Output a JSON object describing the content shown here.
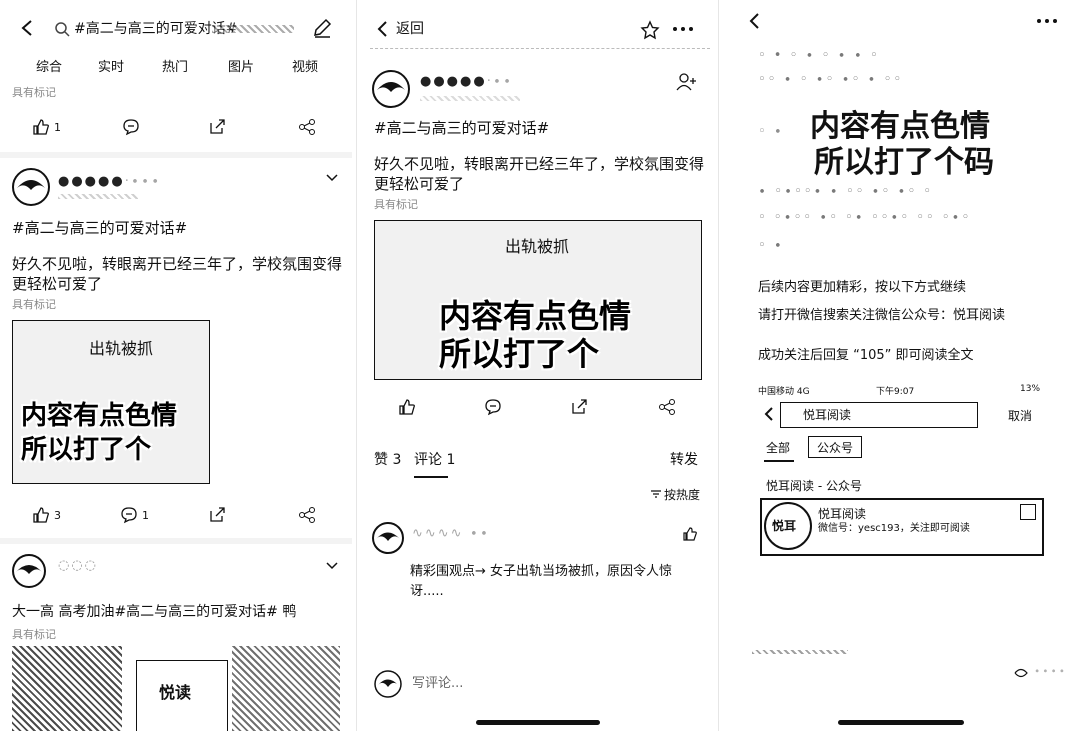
{
  "p1": {
    "search_text": "#高二与高三的可爱对话#",
    "tabs": [
      "综合",
      "实时",
      "热门",
      "图片",
      "视频"
    ],
    "source1": "具有标记",
    "actions1": {
      "like": "1"
    },
    "post": {
      "hashtag": "#高二与高三的可爱对话#",
      "body": "好久不见啦，转眼离开已经三年了，学校氛围变得更轻松可爱了",
      "source": "具有标记",
      "img_small": "出轨被抓",
      "img_big1": "内容有点色情",
      "img_big2": "所以打了个",
      "likes": "3",
      "comments": "1"
    },
    "post2": {
      "body": "大一高  高考加油#高二与高三的可爱对话# 鸭",
      "source": "具有标记",
      "img_tile": "悦读"
    }
  },
  "p2": {
    "back_label": "返回",
    "hashtag": "#高二与高三的可爱对话#",
    "body": "好久不见啦，转眼离开已经三年了，学校氛围变得更轻松可爱了",
    "source": "具有标记",
    "img_small": "出轨被抓",
    "img_big1": "内容有点色情",
    "img_big2": "所以打了个",
    "tabs": {
      "repost": "赞 3",
      "comment": "评论 1",
      "forward": "转发"
    },
    "sort": "按热度",
    "comment_text": "精彩围观点→ 女子出轨当场被抓，原因令人惊讶.....",
    "write_placeholder": "写评论..."
  },
  "p3": {
    "big1": "内容有点色情",
    "big2": "所以打了个码",
    "line1": "后续内容更加精彩，按以下方式继续",
    "line2": "请打开微信搜索关注微信公众号：悦耳阅读",
    "line3": "成功关注后回复 “105” 即可阅读全文",
    "statusbar": {
      "carrier": "中国移动 4G",
      "time": "下午9:07",
      "battery": "13%"
    },
    "search_value": "悦耳阅读",
    "cancel": "取消",
    "tab_all": "全部",
    "tab_gzh": "公众号",
    "result_title": "悦耳阅读 - 公众号",
    "card_name": "悦耳阅读",
    "card_desc": "微信号：yesc193，关注即可阅读",
    "logo_text": "悦耳"
  },
  "colors": {
    "ink": "#111111",
    "muted": "#888888",
    "line": "#e6e6e6"
  }
}
